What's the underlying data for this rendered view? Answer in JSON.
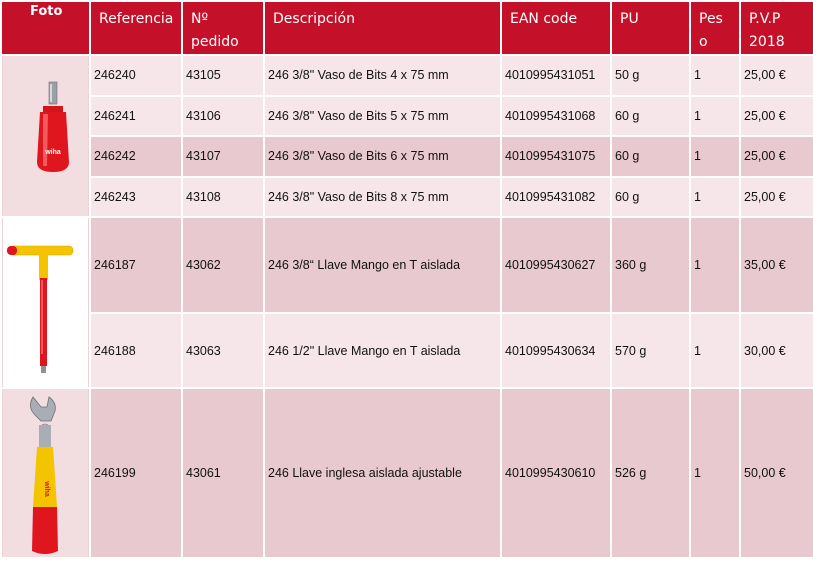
{
  "headers": {
    "foto": "Foto",
    "referencia": "Referencia",
    "pedido_1": "Nº",
    "pedido_2": "pedido",
    "descripcion": "Descripción",
    "ean": "EAN code",
    "pu": "PU",
    "peso_1": "Pes",
    "peso_2": "o",
    "pvp_1": "P.V.P",
    "pvp_2": "2018"
  },
  "rows": [
    {
      "ref": "246240",
      "pedido": "43105",
      "desc": "246 3/8\" Vaso de Bits 4 x 75 mm",
      "ean": "4010995431051",
      "pu": "50 g",
      "peso": "1",
      "pvp": "25,00 €"
    },
    {
      "ref": "246241",
      "pedido": "43106",
      "desc": "246 3/8\" Vaso de Bits 5 x 75 mm",
      "ean": "4010995431068",
      "pu": "60 g",
      "peso": "1",
      "pvp": "25,00 €"
    },
    {
      "ref": "246242",
      "pedido": "43107",
      "desc": "246 3/8\" Vaso de Bits 6 x 75 mm",
      "ean": "4010995431075",
      "pu": "60 g",
      "peso": "1",
      "pvp": "25,00 €"
    },
    {
      "ref": "246243",
      "pedido": "43108",
      "desc": "246 3/8\" Vaso de Bits 8 x 75 mm",
      "ean": "4010995431082",
      "pu": "60 g",
      "peso": "1",
      "pvp": "25,00 €"
    },
    {
      "ref": "246187",
      "pedido": "43062",
      "desc": "246 3/8“ Llave  Mango en  T aislada",
      "ean": "4010995430627",
      "pu": "360 g",
      "peso": "1",
      "pvp": "35,00 €"
    },
    {
      "ref": "246188",
      "pedido": "43063",
      "desc": "246 1/2\" Llave  Mango en  T aislada",
      "ean": "4010995430634",
      "pu": "570 g",
      "peso": "1",
      "pvp": "30,00 €"
    },
    {
      "ref": "246199",
      "pedido": "43061",
      "desc": "246 Llave inglesa  aislada ajustable",
      "ean": "4010995430610",
      "pu": "526 g",
      "peso": "1",
      "pvp": "50,00 €"
    }
  ],
  "images": {
    "socket": {
      "icon": "insulated-socket-icon",
      "brand": "wiha"
    },
    "t_handle": {
      "icon": "t-handle-wrench-icon"
    },
    "adjustable_wrench": {
      "icon": "adjustable-wrench-icon",
      "brand": "wiha"
    }
  },
  "colors": {
    "header": "#c5102a",
    "row_dark": "#e8c9cf",
    "row_light": "#f6e6e9",
    "insulation_red": "#e0161e",
    "insulation_yellow": "#f5c400"
  }
}
